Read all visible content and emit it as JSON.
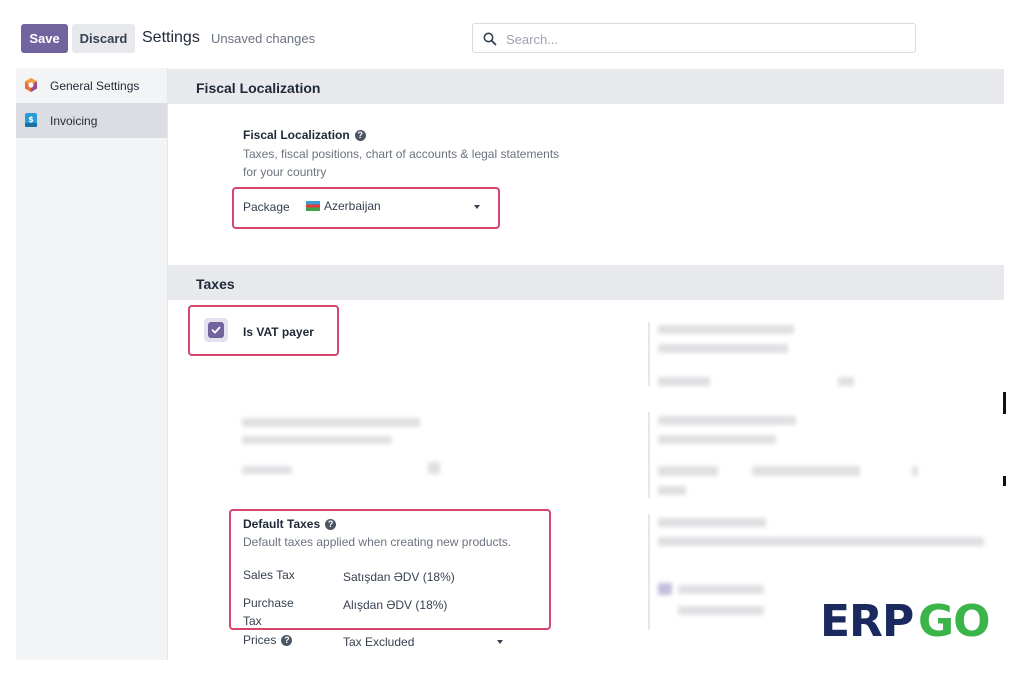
{
  "toolbar": {
    "save_label": "Save",
    "discard_label": "Discard",
    "title": "Settings",
    "status": "Unsaved changes"
  },
  "search": {
    "placeholder": "Search..."
  },
  "sidebar": {
    "items": [
      {
        "label": "General Settings",
        "icon": "odoo-logo-icon"
      },
      {
        "label": "Invoicing",
        "icon": "invoicing-app-icon",
        "active": true
      }
    ]
  },
  "fiscal": {
    "section_title": "Fiscal Localization",
    "setting_title": "Fiscal Localization",
    "description_line1": "Taxes, fiscal positions, chart of accounts & legal statements",
    "description_line2": "for your country",
    "package_label": "Package",
    "package_value": "Azerbaijan",
    "package_flag": "🇦🇿"
  },
  "taxes": {
    "section_title": "Taxes",
    "vat_label": "Is VAT payer",
    "vat_checked": true,
    "default_taxes_title": "Default Taxes",
    "default_taxes_desc": "Default taxes applied when creating new products.",
    "sales_tax_label": "Sales Tax",
    "sales_tax_value": "Satışdan ƏDV (18%)",
    "purchase_tax_label_line1": "Purchase",
    "purchase_tax_label_line2": "Tax",
    "purchase_tax_value": "Alışdan ƏDV (18%)",
    "prices_label": "Prices",
    "prices_value": "Tax Excluded"
  },
  "brand": {
    "logo_text_part1": "ERP",
    "logo_text_part2": "GO",
    "colors": {
      "navy": "#1a2a5e",
      "green": "#3bb54a"
    }
  },
  "colors": {
    "primary": "#71639e",
    "highlight": "#d6456b"
  }
}
